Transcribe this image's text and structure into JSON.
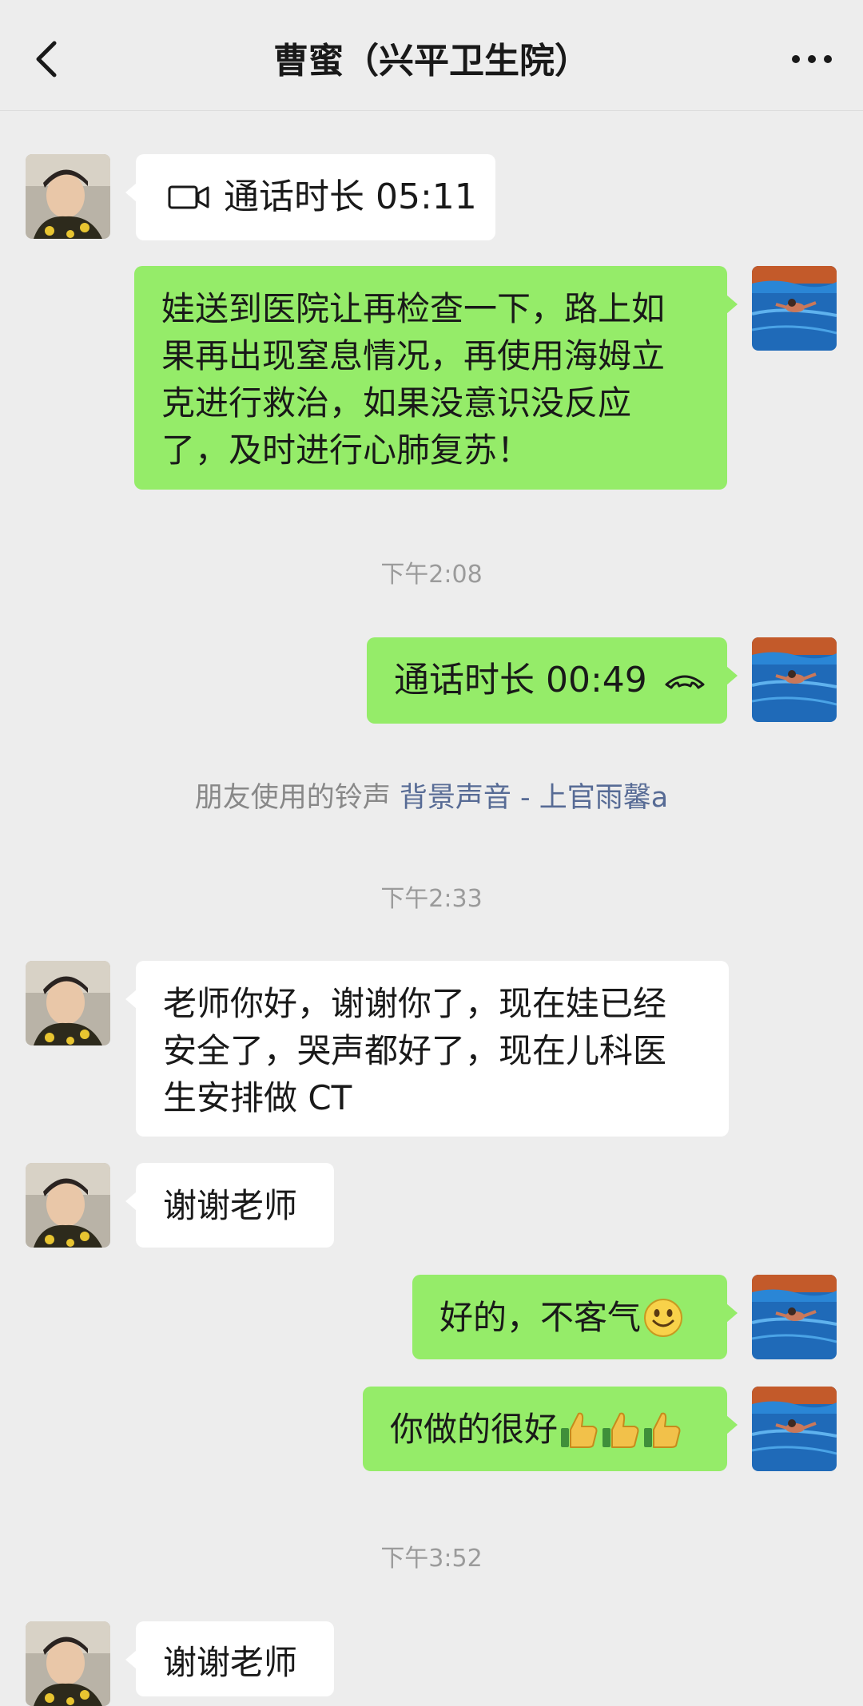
{
  "header": {
    "title": "曹蜜（兴平卫生院）"
  },
  "messages": {
    "m1": "通话时长 05:11",
    "m2_lines": [
      "娃送到医院让再检查一下，路上如",
      "果再出现窒息情况，再使用海姆立",
      "克进行救治，如果没意识没反应",
      "了，及时进行心肺复苏！"
    ],
    "t1": "下午2:08",
    "m3": "通话时长 00:49",
    "ringtone_prefix": "朋友使用的铃声",
    "ringtone_song": "背景声音 - 上官雨馨a",
    "t2": "下午2:33",
    "m4_lines": [
      "老师你好，谢谢你了，现在娃已经",
      "安全了，哭声都好了，现在儿科医",
      "生安排做 CT"
    ],
    "m5": "谢谢老师",
    "m6": "好的，不客气",
    "m7": "你做的很好",
    "t3": "下午3:52",
    "m8": "谢谢老师"
  },
  "icons": {
    "back": "chevron-left-icon",
    "more": "more-dots-icon",
    "video_call": "video-camera-icon",
    "voice_call": "phone-hangup-icon",
    "smile": "smile-emoji-icon",
    "thumbs": "thumbs-up-emoji-icon"
  },
  "colors": {
    "background": "#ededed",
    "bubble_self": "#95ec69",
    "bubble_other": "#ffffff",
    "link": "#576b95"
  }
}
